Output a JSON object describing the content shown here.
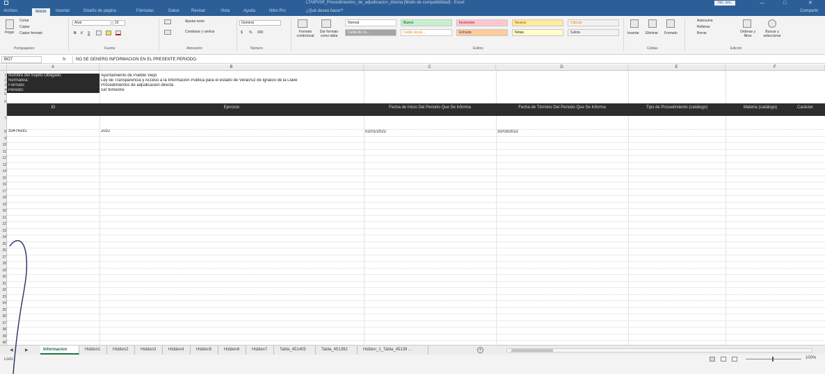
{
  "window": {
    "title": "LTAIPVIIIf_Procedimientos_de_adjudicacion_directa [Modo de compatibilidad] - Excel",
    "signin_label": "Inic. ses.",
    "minimize": "—",
    "restore": "□",
    "close": "✕"
  },
  "ribbon_tabs": [
    "Archivo",
    "Inicio",
    "Insertar",
    "Diseño de página",
    "Fórmulas",
    "Datos",
    "Revisar",
    "Vista",
    "Ayuda",
    "Nitro Pro",
    "¿Qué desea hacer?"
  ],
  "share_label": "Compartir",
  "ribbon": {
    "clipboard": {
      "paste": "Pegar",
      "cut": "Cortar",
      "copy": "Copiar",
      "format_painter": "Copiar formato",
      "group": "Portapapeles"
    },
    "font": {
      "name": "Arial",
      "size": "10",
      "bold": "N",
      "italic": "K",
      "underline": "S",
      "group": "Fuente"
    },
    "alignment": {
      "wrap": "Ajustar texto",
      "merge": "Combinar y centrar",
      "group": "Alineación"
    },
    "number": {
      "format": "General",
      "currency": "$",
      "percent": "%",
      "thousands": "000",
      "group": "Número"
    },
    "styles": {
      "conditional": "Formato condicional",
      "as_table": "Dar formato como tabla",
      "cells": [
        {
          "label": "Normal",
          "bg": "#ffffff",
          "fg": "#222222"
        },
        {
          "label": "Bueno",
          "bg": "#c6efce",
          "fg": "#006100"
        },
        {
          "label": "Incorrecto",
          "bg": "#ffc7ce",
          "fg": "#9c0006"
        },
        {
          "label": "Neutral",
          "bg": "#ffeb9c",
          "fg": "#9c5700"
        },
        {
          "label": "Cálculo",
          "bg": "#f2f2f2",
          "fg": "#fa7d00"
        },
        {
          "label": "Celda de co...",
          "bg": "#a5a5a5",
          "fg": "#ffffff"
        },
        {
          "label": "Celda vincul...",
          "bg": "#ffffff",
          "fg": "#fa7d00"
        },
        {
          "label": "Entrada",
          "bg": "#ffcc99",
          "fg": "#3f3f76"
        },
        {
          "label": "Notas",
          "bg": "#ffffcc",
          "fg": "#222222"
        },
        {
          "label": "Salida",
          "bg": "#f2f2f2",
          "fg": "#3f3f3f"
        }
      ],
      "group": "Estilos"
    },
    "cells": {
      "insert": "Insertar",
      "delete": "Eliminar",
      "format": "Formato",
      "group": "Celdas"
    },
    "editing": {
      "autosum": "Autosuma",
      "fill": "Rellenar",
      "clear": "Borrar",
      "sort": "Ordenar y filtrar",
      "find": "Buscar y seleccionar",
      "group": "Edición"
    }
  },
  "formula_bar": {
    "name_box": "BO7",
    "fx": "fx",
    "content": "NO SE GENERO INFORMACION EN EL PRESENTE PERIODO."
  },
  "column_headers": [
    "A",
    "B",
    "C",
    "D",
    "E",
    "F"
  ],
  "info_labels": [
    "Nombre del Sujeto Obligado:",
    "Normativa:",
    "Formato:",
    "Periodo:"
  ],
  "info_values": [
    "Ayuntamiento de Pueblo Viejo",
    "Ley de Transparencia y Acceso a la Información Pública para el estado de Veracruz de Ignacio de la Llave",
    "Procedimientos de adjudicación directa",
    "1er trimestre"
  ],
  "table_headers": [
    "ID",
    "Ejercicio",
    "Fecha de Inicio Del Periodo Que Se Informa",
    "Fecha de Término Del Periodo Que Se Informa",
    "Tipo de Procedimiento (catálogo)",
    "Materia (catálogo)",
    "Carácter"
  ],
  "data_row": {
    "id": "33474931",
    "ejercicio": "2022",
    "fecha_inicio": "01/01/2022",
    "fecha_termino": "31/03/2022"
  },
  "sheet_tabs": [
    "Informacion",
    "Hidden1",
    "Hidden2",
    "Hidden3",
    "Hidden4",
    "Hidden5",
    "Hidden6",
    "Hidden7",
    "Tabla_451405",
    "Tabla_451392",
    "Hidden_1_Tabla_45139 ..."
  ],
  "add_sheet": "+",
  "status": {
    "text": "Listo",
    "zoom": "100%"
  }
}
